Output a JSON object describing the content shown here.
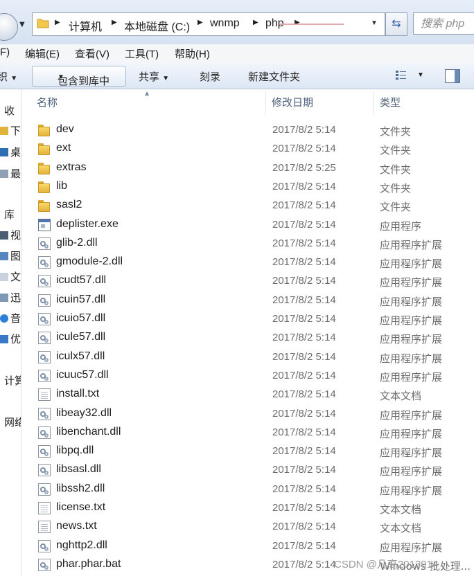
{
  "address_bar": {
    "breadcrumbs": [
      "计算机",
      "本地磁盘 (C:)",
      "wnmp",
      "php"
    ],
    "search_placeholder": "搜索 php"
  },
  "menu_bar": {
    "items": [
      "F)",
      "编辑(E)",
      "查看(V)",
      "工具(T)",
      "帮助(H)"
    ]
  },
  "toolbar": {
    "organize_partial": "织",
    "include_in_library": "包含到库中",
    "share": "共享",
    "burn": "刻录",
    "new_folder": "新建文件夹"
  },
  "nav_pane": {
    "items": [
      {
        "label": "收",
        "icon": "star-icon"
      },
      {
        "label": "下",
        "icon": "download-folder-icon"
      },
      {
        "label": "桌",
        "icon": "desktop-icon"
      },
      {
        "label": "最",
        "icon": "recent-places-icon"
      },
      {
        "label": "库",
        "icon": ""
      },
      {
        "label": "视",
        "icon": "video-library-icon"
      },
      {
        "label": "图",
        "icon": "picture-library-icon"
      },
      {
        "label": "文",
        "icon": "document-library-icon"
      },
      {
        "label": "迅",
        "icon": "thunder-library-icon"
      },
      {
        "label": "音",
        "icon": "music-library-icon"
      },
      {
        "label": "优",
        "icon": "youku-library-icon"
      },
      {
        "label": "计算",
        "icon": ""
      },
      {
        "label": "网络",
        "icon": ""
      }
    ]
  },
  "columns": {
    "name": "名称",
    "modified": "修改日期",
    "type": "类型"
  },
  "files": [
    {
      "name": "dev",
      "date": "2017/8/2 5:14",
      "type": "文件夹",
      "icon": "folder-icon"
    },
    {
      "name": "ext",
      "date": "2017/8/2 5:14",
      "type": "文件夹",
      "icon": "folder-icon"
    },
    {
      "name": "extras",
      "date": "2017/8/2 5:25",
      "type": "文件夹",
      "icon": "folder-icon"
    },
    {
      "name": "lib",
      "date": "2017/8/2 5:14",
      "type": "文件夹",
      "icon": "folder-icon"
    },
    {
      "name": "sasl2",
      "date": "2017/8/2 5:14",
      "type": "文件夹",
      "icon": "folder-icon"
    },
    {
      "name": "deplister.exe",
      "date": "2017/8/2 5:14",
      "type": "应用程序",
      "icon": "exe-icon"
    },
    {
      "name": "glib-2.dll",
      "date": "2017/8/2 5:14",
      "type": "应用程序扩展",
      "icon": "dll-icon"
    },
    {
      "name": "gmodule-2.dll",
      "date": "2017/8/2 5:14",
      "type": "应用程序扩展",
      "icon": "dll-icon"
    },
    {
      "name": "icudt57.dll",
      "date": "2017/8/2 5:14",
      "type": "应用程序扩展",
      "icon": "dll-icon"
    },
    {
      "name": "icuin57.dll",
      "date": "2017/8/2 5:14",
      "type": "应用程序扩展",
      "icon": "dll-icon"
    },
    {
      "name": "icuio57.dll",
      "date": "2017/8/2 5:14",
      "type": "应用程序扩展",
      "icon": "dll-icon"
    },
    {
      "name": "icule57.dll",
      "date": "2017/8/2 5:14",
      "type": "应用程序扩展",
      "icon": "dll-icon"
    },
    {
      "name": "iculx57.dll",
      "date": "2017/8/2 5:14",
      "type": "应用程序扩展",
      "icon": "dll-icon"
    },
    {
      "name": "icuuc57.dll",
      "date": "2017/8/2 5:14",
      "type": "应用程序扩展",
      "icon": "dll-icon"
    },
    {
      "name": "install.txt",
      "date": "2017/8/2 5:14",
      "type": "文本文档",
      "icon": "text-file-icon"
    },
    {
      "name": "libeay32.dll",
      "date": "2017/8/2 5:14",
      "type": "应用程序扩展",
      "icon": "dll-icon"
    },
    {
      "name": "libenchant.dll",
      "date": "2017/8/2 5:14",
      "type": "应用程序扩展",
      "icon": "dll-icon"
    },
    {
      "name": "libpq.dll",
      "date": "2017/8/2 5:14",
      "type": "应用程序扩展",
      "icon": "dll-icon"
    },
    {
      "name": "libsasl.dll",
      "date": "2017/8/2 5:14",
      "type": "应用程序扩展",
      "icon": "dll-icon"
    },
    {
      "name": "libssh2.dll",
      "date": "2017/8/2 5:14",
      "type": "应用程序扩展",
      "icon": "dll-icon"
    },
    {
      "name": "license.txt",
      "date": "2017/8/2 5:14",
      "type": "文本文档",
      "icon": "text-file-icon"
    },
    {
      "name": "news.txt",
      "date": "2017/8/2 5:14",
      "type": "文本文档",
      "icon": "text-file-icon"
    },
    {
      "name": "nghttp2.dll",
      "date": "2017/8/2 5:14",
      "type": "应用程序扩展",
      "icon": "dll-icon"
    },
    {
      "name": "phar.phar.bat",
      "date": "2017/8/2 5:14",
      "type": "Windows 批处理...",
      "icon": "bat-icon"
    }
  ],
  "watermark": "CSDN @凡高2013914"
}
